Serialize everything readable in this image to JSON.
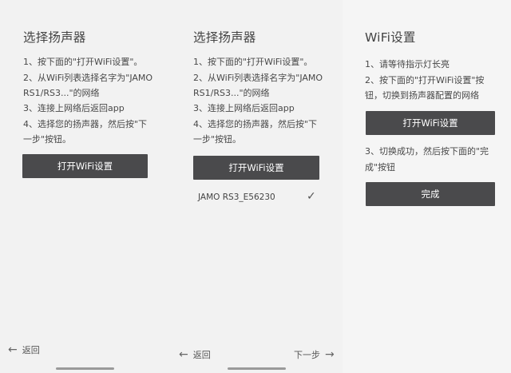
{
  "panel1": {
    "title": "选择扬声器",
    "steps": [
      "1、按下面的\"打开WiFi设置\"。",
      "2、从WiFi列表选择名字为\"JAMO",
      "RS1/RS3...\"的网络",
      "3、连接上网络后返回app",
      "4、选择您的扬声器，然后按\"下",
      "一步\"按钮。"
    ],
    "button": "打开WiFi设置",
    "back": "返回"
  },
  "panel2": {
    "title": "选择扬声器",
    "steps": [
      "1、按下面的\"打开WiFi设置\"。",
      "2、从WiFi列表选择名字为\"JAMO",
      "RS1/RS3...\"的网络",
      "3、连接上网络后返回app",
      "4、选择您的扬声器，然后按\"下",
      "一步\"按钮。"
    ],
    "button": "打开WiFi设置",
    "network": "JAMO RS3_E56230",
    "check": "✓",
    "back": "返回",
    "next": "下一步"
  },
  "panel3": {
    "title": "WiFi设置",
    "steps_a": [
      "1、请等待指示灯长亮",
      "2、按下面的\"打开WiFi设置\"按",
      "钮，切换到扬声器配置的网络"
    ],
    "button": "打开WiFi设置",
    "steps_b": [
      "3、切换成功，然后按下面的\"完",
      "成\"按钮"
    ],
    "done": "完成"
  },
  "icons": {
    "back": "←",
    "next": "→"
  }
}
